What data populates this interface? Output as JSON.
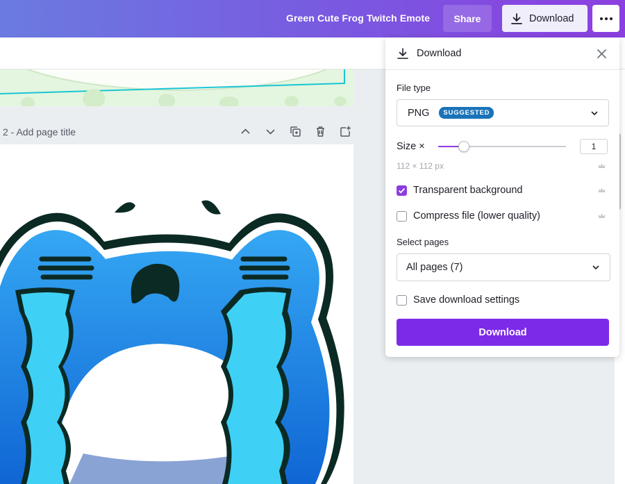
{
  "header": {
    "doc_title": "Green Cute Frog Twitch Emote",
    "share_label": "Share",
    "download_label": "Download",
    "more_icon": "more-horizontal-icon"
  },
  "canvas": {
    "page_label": "2 - Add page title",
    "tools": [
      "chevron-up-icon",
      "chevron-down-icon",
      "duplicate-page-icon",
      "trash-icon",
      "add-page-icon"
    ]
  },
  "download_panel": {
    "title": "Download",
    "file_type_label": "File type",
    "file_type_value": "PNG",
    "suggested_badge": "SUGGESTED",
    "size_label": "Size ×",
    "size_value": "1",
    "size_fraction": 0.2,
    "dimensions": "112 × 112 px",
    "transparent_label": "Transparent background",
    "transparent_checked": true,
    "compress_label": "Compress file (lower quality)",
    "compress_checked": false,
    "select_pages_label": "Select pages",
    "select_pages_value": "All pages (7)",
    "save_settings_label": "Save download settings",
    "save_settings_checked": false,
    "download_button": "Download"
  },
  "colors": {
    "accent": "#7d2ae8",
    "badge": "#1a73b8",
    "frog_blue": "#1f7fe0",
    "tears": "#3fd1f5"
  }
}
